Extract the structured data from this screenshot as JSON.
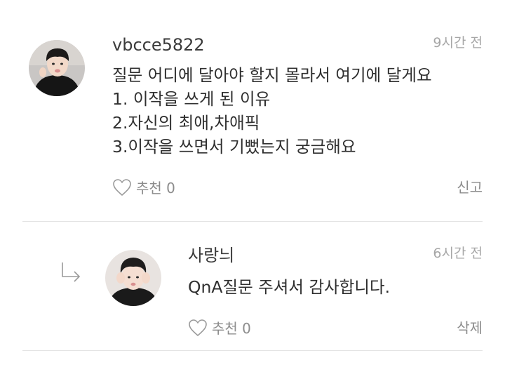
{
  "comment": {
    "username": "vbcce5822",
    "time": "9시간 전",
    "lines": [
      "질문 어디에 달아야 할지 몰라서 여기에 달게요",
      "1. 이작을 쓰게 된 이유",
      "2.자신의 최애,차애픽",
      "3.이작을 쓰면서 기뻤는지 궁금해요"
    ],
    "like_label": "추천 0",
    "action": "신고"
  },
  "reply": {
    "username": "사랑늬",
    "time": "6시간 전",
    "text": "QnA질문 주셔서 감사합니다.",
    "like_label": "추천 0",
    "action": "삭제"
  }
}
